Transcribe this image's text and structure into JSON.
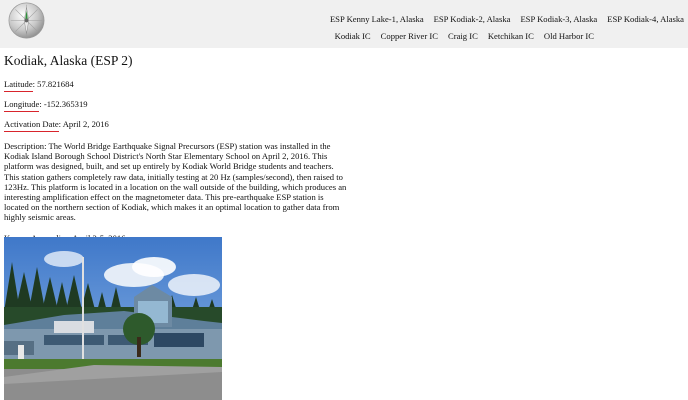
{
  "nav": {
    "row1": [
      "ESP Kenny Lake-1, Alaska",
      "ESP Kodiak-2, Alaska",
      "ESP Kodiak-3, Alaska",
      "ESP Kodiak-4, Alaska"
    ],
    "row2": [
      "Kodiak IC",
      "Copper River IC",
      "Craig IC",
      "Ketchikan IC",
      "Old Harbor IC"
    ]
  },
  "page": {
    "title": "Kodiak, Alaska (ESP 2)",
    "latitude_label": "Latitude",
    "latitude_value": ": 57.821684",
    "longitude_label": "Longitude",
    "longitude_value": ": -152.365319",
    "activation_label": "Activation Date",
    "activation_value": ": April 2, 2016",
    "description": "Description: The World Bridge Earthquake Signal Precursors (ESP) station was installed in the Kodiak Island Borough School District's North Star Elementary School on April 2, 2016. This platform was designed, built, and set up entirely by Kodiak World Bridge students and teachers. This station gathers completely raw data, initially testing at 20 Hz (samples/second), then raised to 123Hz. This platform is located in a location on the wall outside of the building, which produces an interesting amplification effect on the magnetometer data. This pre-earthquake ESP station is located on the northern section of Kodiak, which makes it an optimal location to gather data from highly seismic areas.",
    "anomalies": "Known Anomalies: April 2-5, 2016"
  },
  "colors": {
    "topbar_bg": "#f0f0f0",
    "underline": "#d8242c"
  },
  "icons": {
    "logo": "compass-logo-icon"
  }
}
